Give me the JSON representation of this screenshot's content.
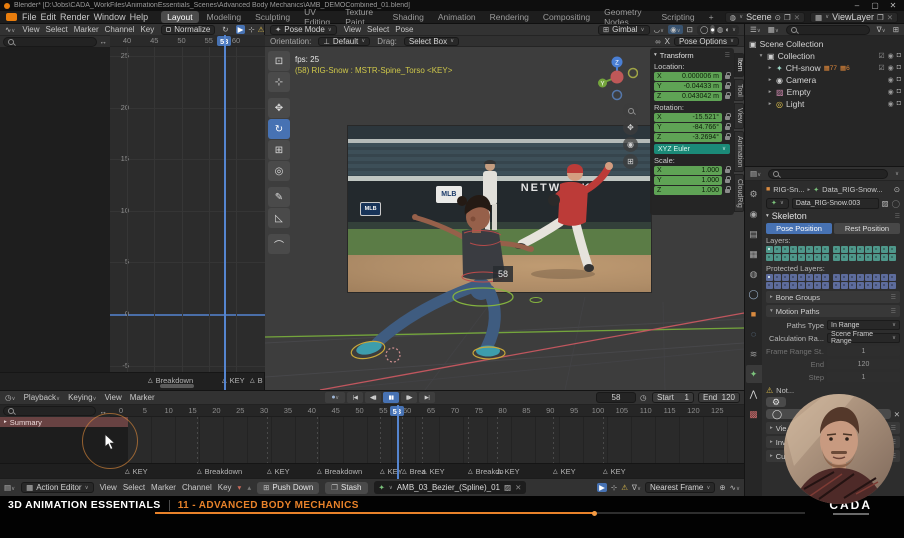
{
  "window": {
    "title": "Blender* [D:\\Jobs\\CADA_WorkFiles\\AnimationEssentials_Scenes\\Advanced Body Mechanics\\AMB_DEMOCombined_01.blend]"
  },
  "topbar": {
    "menus": [
      "File",
      "Edit",
      "Render",
      "Window",
      "Help"
    ],
    "workspaces": [
      "Layout",
      "Modeling",
      "Sculpting",
      "UV Editing",
      "Texture Paint",
      "Shading",
      "Animation",
      "Rendering",
      "Compositing",
      "Geometry Nodes",
      "Scripting",
      "+"
    ],
    "active_workspace": "Layout",
    "scene": "Scene",
    "view_layer": "ViewLayer"
  },
  "graph": {
    "menus": [
      "View",
      "Select",
      "Marker",
      "Channel",
      "Key"
    ],
    "normalize": "Normalize",
    "yticks": [
      "25",
      "20",
      "15",
      "10",
      "5",
      "0",
      "-5"
    ],
    "ruler_frames": [
      40,
      45,
      50,
      55,
      60
    ],
    "current_frame": "58",
    "markers": [
      {
        "x": 148,
        "label": "Breakdown"
      },
      {
        "x": 222,
        "label": "KEY"
      },
      {
        "x": 250,
        "label": "B"
      }
    ]
  },
  "viewport": {
    "mode": "Pose Mode",
    "menus": [
      "View",
      "Select",
      "Pose"
    ],
    "orientation_label": "Orientation:",
    "orientation": "Default",
    "drag_label": "Drag:",
    "drag": "Select Box",
    "gimbal": "Gimbal",
    "mirror_x": "X",
    "pose_options": "Pose Options",
    "fps": "fps: 25",
    "bone_info": "(58) RIG-Snow : MSTR-Spine_Torso <KEY>",
    "frame_badge": "58",
    "mlb": "MLB",
    "network": "NETWORK",
    "tools": [
      {
        "name": "select-box",
        "icon": "⊡"
      },
      {
        "name": "cursor",
        "icon": "⊹"
      },
      {
        "name": "move",
        "icon": "✥"
      },
      {
        "name": "rotate",
        "icon": "↻"
      },
      {
        "name": "scale",
        "icon": "⊞"
      },
      {
        "name": "transform",
        "icon": "◎"
      },
      {
        "name": "annotate",
        "icon": "✎"
      },
      {
        "name": "measure",
        "icon": "◺"
      },
      {
        "name": "pose-breakdowner",
        "icon": "⌒"
      }
    ],
    "active_tool_index": 3
  },
  "sidebar": {
    "title": "Transform",
    "tabs": [
      "Item",
      "Tool",
      "View",
      "Animation",
      "CloudRig"
    ],
    "active_tab": "Item",
    "location_label": "Location:",
    "rotation_label": "Rotation:",
    "scale_label": "Scale:",
    "euler_mode": "XYZ Euler",
    "location": [
      {
        "axis": "X",
        "value": "0.000006 m"
      },
      {
        "axis": "Y",
        "value": "-0.04433 m"
      },
      {
        "axis": "Z",
        "value": "0.043042 m"
      }
    ],
    "rotation": [
      {
        "axis": "X",
        "value": "-15.521°"
      },
      {
        "axis": "Y",
        "value": "-84.766°"
      },
      {
        "axis": "Z",
        "value": "-3.2694°"
      }
    ],
    "scale": [
      {
        "axis": "X",
        "value": "1.000"
      },
      {
        "axis": "Y",
        "value": "1.000"
      },
      {
        "axis": "Z",
        "value": "1.000"
      }
    ]
  },
  "outliner": {
    "root": "Scene Collection",
    "items": [
      {
        "label": "Collection",
        "depth": 1,
        "icon": "collection",
        "expanded": true,
        "check": true,
        "badges": []
      },
      {
        "label": "CH-snow",
        "depth": 2,
        "icon": "armature",
        "check": true,
        "badges": [
          "77",
          "6"
        ]
      },
      {
        "label": "Camera",
        "depth": 2,
        "icon": "camera",
        "badges": []
      },
      {
        "label": "Empty",
        "depth": 2,
        "icon": "image",
        "badges": []
      },
      {
        "label": "Light",
        "depth": 2,
        "icon": "light",
        "badges": []
      }
    ]
  },
  "properties": {
    "breadcrumb_object": "RIG-Sn...",
    "breadcrumb_data": "Data_RIG-Snow...",
    "name": "Data_RIG-Snow.003",
    "skeleton": "Skeleton",
    "pose_position": "Pose Position",
    "rest_position": "Rest Position",
    "layers_label": "Layers:",
    "protected_label": "Protected Layers:",
    "bone_groups": "Bone Groups",
    "motion_paths": "Motion Paths",
    "tabs": [
      "tool",
      "render",
      "output",
      "view-layer",
      "scene",
      "world",
      "object",
      "physics",
      "constraints",
      "object-data",
      "bone",
      "texture"
    ],
    "active_tab": "object-data",
    "rows": [
      {
        "label": "Paths Type",
        "value": "In Range",
        "type": "dropdown"
      },
      {
        "label": "Calculation Ra...",
        "value": "Scene Frame Range",
        "type": "dropdown"
      },
      {
        "label": "Frame Range St...",
        "value": "1",
        "type": "number"
      },
      {
        "label": "End",
        "value": "120",
        "type": "number"
      },
      {
        "label": "Step",
        "value": "1",
        "type": "number"
      }
    ],
    "warning": "Not...",
    "panels": [
      "Vie...",
      "Invers...",
      "Custom Prop..."
    ]
  },
  "timeline": {
    "menus": [
      "Playback",
      "Keying",
      "View",
      "Marker"
    ],
    "transport": [
      "jump-start",
      "prev-key",
      "pause",
      "next-key",
      "jump-end"
    ],
    "frame": "58",
    "start_label": "Start",
    "start": "1",
    "end_label": "End",
    "end": "120",
    "summary": "Summary",
    "ruler_start": 0,
    "ruler_end": 125,
    "ruler_step": 5,
    "current_frame": 58,
    "markers": [
      {
        "x": 125,
        "label": "KEY"
      },
      {
        "x": 197,
        "label": "Breakdown"
      },
      {
        "x": 267,
        "label": "KEY"
      },
      {
        "x": 317,
        "label": "Breakdown"
      },
      {
        "x": 380,
        "label": "KEY"
      },
      {
        "x": 402,
        "label": "Brea"
      },
      {
        "x": 422,
        "label": "KEY"
      },
      {
        "x": 468,
        "label": "Breakdo"
      },
      {
        "x": 497,
        "label": "KEY"
      },
      {
        "x": 553,
        "label": "KEY"
      },
      {
        "x": 603,
        "label": "KEY"
      }
    ]
  },
  "actionbar": {
    "editor": "Action Editor",
    "menus": [
      "View",
      "Select",
      "Marker",
      "Channel",
      "Key"
    ],
    "push_down": "Push Down",
    "stash": "Stash",
    "action_name": "AMB_03_Bezier_(Spline)_01",
    "nearest_frame": "Nearest Frame"
  },
  "footer": {
    "course": "3D ANIMATION ESSENTIALS",
    "lesson": "11 - ADVANCED BODY MECHANICS",
    "logo": "CADA"
  },
  "colors": {
    "accent": "#4772b3",
    "key_green": "#5fa355",
    "euler_teal": "#1b8a78",
    "orange": "#e8822a"
  }
}
